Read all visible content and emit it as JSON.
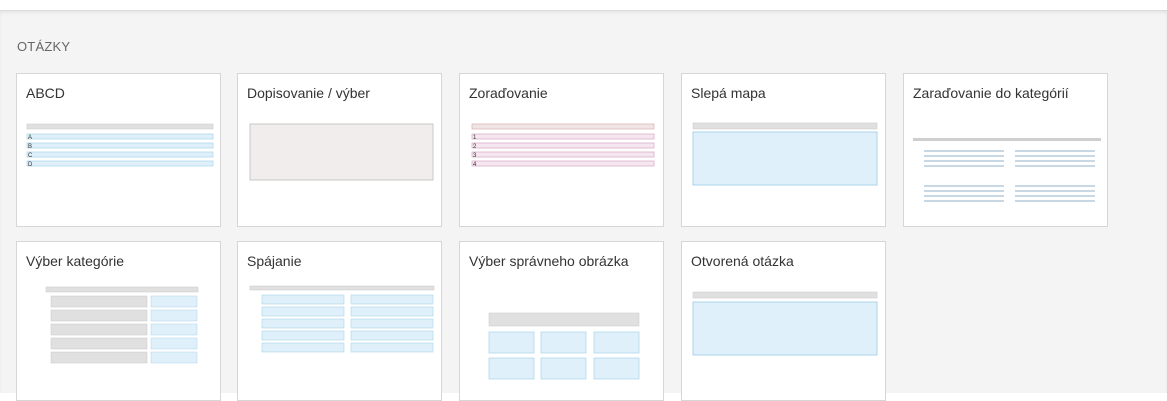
{
  "section": {
    "title": "OTÁZKY"
  },
  "cards": [
    {
      "label": "ABCD",
      "type": "abcd",
      "markers": [
        "A",
        "B",
        "C",
        "D"
      ]
    },
    {
      "label": "Dopisovanie / výber",
      "type": "fill"
    },
    {
      "label": "Zoraďovanie",
      "type": "order",
      "markers": [
        "1",
        "2",
        "3",
        "4"
      ]
    },
    {
      "label": "Slepá mapa",
      "type": "map"
    },
    {
      "label": "Zaraďovanie do kategórií",
      "type": "categorize"
    },
    {
      "label": "Výber kategórie",
      "type": "choose-category"
    },
    {
      "label": "Spájanie",
      "type": "connect"
    },
    {
      "label": "Výber správneho obrázka",
      "type": "image-choice"
    },
    {
      "label": "Otvorená otázka",
      "type": "open"
    }
  ],
  "colors": {
    "blue_fill": "#dff0fa",
    "blue_border": "#a9d3ea",
    "pink_fill": "#f5e6f0",
    "pink_border": "#d6a9c4",
    "gray_bar": "#e0e0e0",
    "gray_border": "#c8c8c8",
    "fill_box": "#f1eded"
  }
}
